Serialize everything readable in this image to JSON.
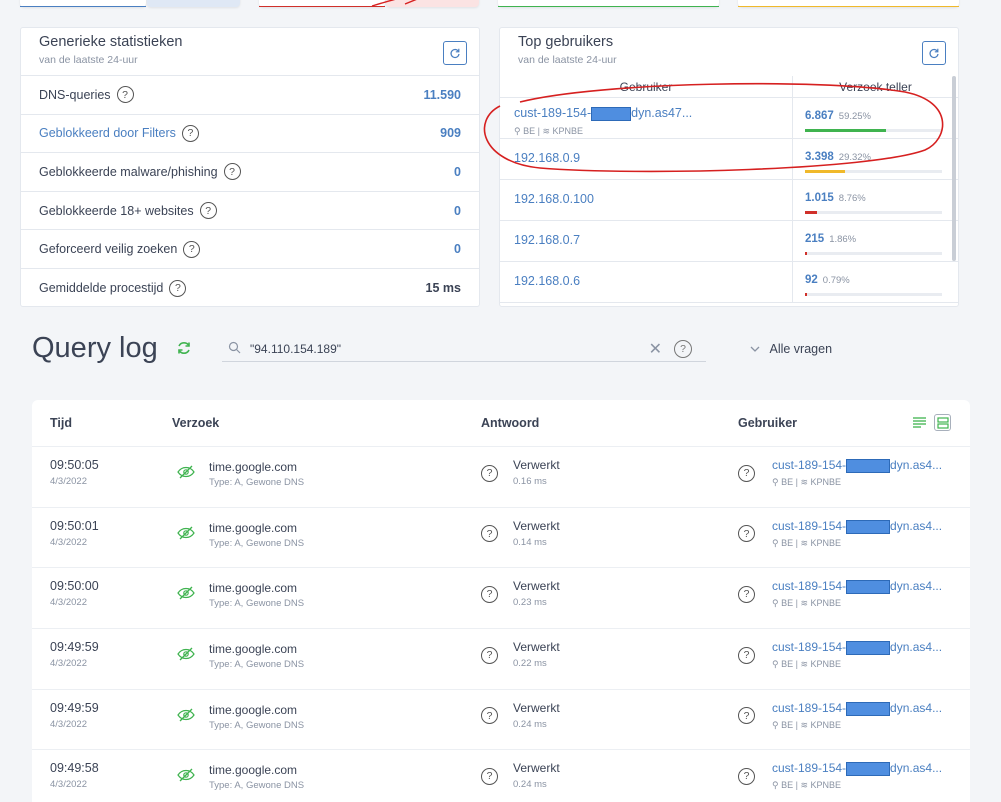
{
  "colors": {
    "accent": "#4a7fc1",
    "green": "#3fb34f",
    "yellow": "#f0b92b",
    "red": "#d0302a",
    "annotation": "#d62020"
  },
  "stats_card": {
    "title": "Generieke statistieken",
    "subtitle": "van de laatste 24-uur",
    "refresh_icon": "refresh-icon",
    "rows": [
      {
        "label": "DNS-queries",
        "value": "11.590",
        "link": false,
        "value_accent": true
      },
      {
        "label": "Geblokkeerd door Filters",
        "value": "909",
        "link": true,
        "value_accent": true
      },
      {
        "label": "Geblokkeerde malware/phishing",
        "value": "0",
        "link": false,
        "value_accent": true
      },
      {
        "label": "Geblokkeerde 18+ websites",
        "value": "0",
        "link": false,
        "value_accent": true
      },
      {
        "label": "Geforceerd veilig zoeken",
        "value": "0",
        "link": false,
        "value_accent": true
      },
      {
        "label": "Gemiddelde procestijd",
        "value": "15 ms",
        "link": false,
        "value_accent": false
      }
    ]
  },
  "top_users": {
    "title": "Top gebruikers",
    "subtitle": "van de laatste 24-uur",
    "col_user": "Gebruiker",
    "col_count": "Verzoek teller",
    "rows": [
      {
        "user_prefix": "cust-189-154-",
        "user_suffix": "dyn.as47...",
        "redacted": true,
        "country": "BE",
        "network": "KPNBE",
        "count": "6.867",
        "pct": "59.25%",
        "share": 0.5925,
        "bar_color": "#3fb34f"
      },
      {
        "user_prefix": "192.168.0.9",
        "user_suffix": "",
        "redacted": false,
        "country": "",
        "network": "",
        "count": "3.398",
        "pct": "29.32%",
        "share": 0.2932,
        "bar_color": "#f0b92b"
      },
      {
        "user_prefix": "192.168.0.100",
        "user_suffix": "",
        "redacted": false,
        "country": "",
        "network": "",
        "count": "1.015",
        "pct": "8.76%",
        "share": 0.0876,
        "bar_color": "#d0302a"
      },
      {
        "user_prefix": "192.168.0.7",
        "user_suffix": "",
        "redacted": false,
        "country": "",
        "network": "",
        "count": "215",
        "pct": "1.86%",
        "share": 0.0186,
        "bar_color": "#d0302a"
      },
      {
        "user_prefix": "192.168.0.6",
        "user_suffix": "",
        "redacted": false,
        "country": "",
        "network": "",
        "count": "92",
        "pct": "0.79%",
        "share": 0.0079,
        "bar_color": "#d0302a"
      }
    ]
  },
  "query_log": {
    "title": "Query log",
    "search_value": "\"94.110.154.189\"",
    "filter_label": "Alle vragen",
    "headers": {
      "time": "Tijd",
      "request": "Verzoek",
      "answer": "Antwoord",
      "user": "Gebruiker"
    },
    "rows": [
      {
        "time": "09:50:05",
        "date": "4/3/2022",
        "domain": "time.google.com",
        "type": "Type: A, Gewone DNS",
        "status": "Verwerkt",
        "ms": "0.16 ms",
        "user_prefix": "cust-189-154-",
        "user_suffix": "dyn.as4...",
        "country": "BE",
        "network": "KPNBE"
      },
      {
        "time": "09:50:01",
        "date": "4/3/2022",
        "domain": "time.google.com",
        "type": "Type: A, Gewone DNS",
        "status": "Verwerkt",
        "ms": "0.14 ms",
        "user_prefix": "cust-189-154-",
        "user_suffix": "dyn.as4...",
        "country": "BE",
        "network": "KPNBE"
      },
      {
        "time": "09:50:00",
        "date": "4/3/2022",
        "domain": "time.google.com",
        "type": "Type: A, Gewone DNS",
        "status": "Verwerkt",
        "ms": "0.23 ms",
        "user_prefix": "cust-189-154-",
        "user_suffix": "dyn.as4...",
        "country": "BE",
        "network": "KPNBE"
      },
      {
        "time": "09:49:59",
        "date": "4/3/2022",
        "domain": "time.google.com",
        "type": "Type: A, Gewone DNS",
        "status": "Verwerkt",
        "ms": "0.22 ms",
        "user_prefix": "cust-189-154-",
        "user_suffix": "dyn.as4...",
        "country": "BE",
        "network": "KPNBE"
      },
      {
        "time": "09:49:59",
        "date": "4/3/2022",
        "domain": "time.google.com",
        "type": "Type: A, Gewone DNS",
        "status": "Verwerkt",
        "ms": "0.24 ms",
        "user_prefix": "cust-189-154-",
        "user_suffix": "dyn.as4...",
        "country": "BE",
        "network": "KPNBE"
      },
      {
        "time": "09:49:58",
        "date": "4/3/2022",
        "domain": "time.google.com",
        "type": "Type: A, Gewone DNS",
        "status": "Verwerkt",
        "ms": "0.24 ms",
        "user_prefix": "cust-189-154-",
        "user_suffix": "dyn.as4...",
        "country": "BE",
        "network": "KPNBE"
      }
    ]
  }
}
